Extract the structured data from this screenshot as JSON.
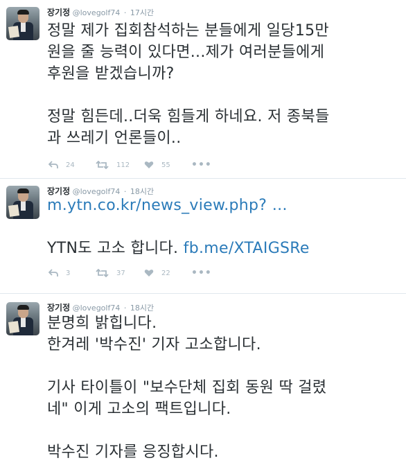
{
  "tweets": [
    {
      "name": "장기정",
      "handle": "@lovegolf74",
      "time": "17시간",
      "lines": [
        "정말 제가 집회참석하는 분들에게 일당15만",
        "원을 줄 능력이 있다면...제가 여러분들에게",
        "후원을 받겠습니까?",
        "",
        "정말 힘든데..더욱 힘들게 하네요. 저 종북들",
        "과 쓰레기 언론들이.."
      ],
      "replies": "24",
      "retweets": "112",
      "likes": "55"
    },
    {
      "name": "장기정",
      "handle": "@lovegolf74",
      "time": "18시간",
      "link1": "m.ytn.co.kr/news_view.php?  …",
      "line2_prefix": "YTN도 고소 합니다. ",
      "link2": "fb.me/XTAIGSRe",
      "replies": "3",
      "retweets": "37",
      "likes": "22"
    },
    {
      "name": "장기정",
      "handle": "@lovegolf74",
      "time": "18시간",
      "lines": [
        "분명희 밝힙니다.",
        "한겨레 '박수진' 기자 고소합니다.",
        "",
        "기사 타이틀이 \"보수단체 집회 동원 딱 걸렸",
        "네\" 이게 고소의 팩트입니다.",
        "",
        "박수진 기자를 응징합시다."
      ]
    }
  ],
  "icons": {
    "reply": "reply-icon",
    "retweet": "retweet-icon",
    "like": "heart-icon",
    "more": "more-icon"
  },
  "more_label": "•••",
  "colors": {
    "text": "#292f33",
    "muted": "#8899a6",
    "link": "#2b7bb9",
    "action": "#aab8c2",
    "divider": "#e1e8ed"
  }
}
